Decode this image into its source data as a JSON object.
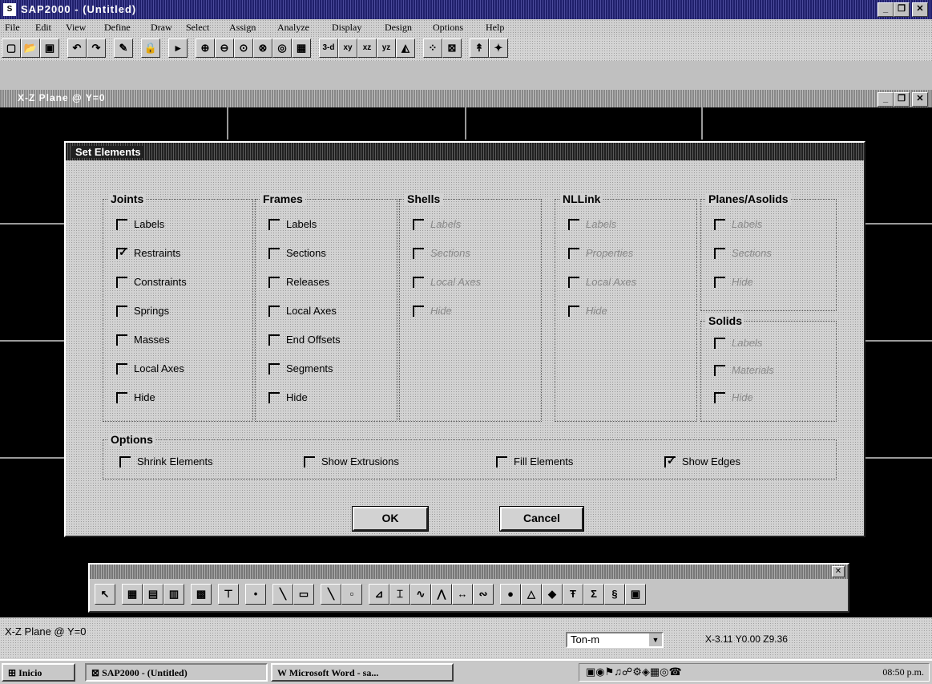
{
  "app": {
    "title": "SAP2000 - (Untitled)",
    "inner_window_title": "X-Z Plane @ Y=0"
  },
  "menu": [
    "File",
    "Edit",
    "View",
    "Define",
    "Draw",
    "Select",
    "Assign",
    "Analyze",
    "Display",
    "Design",
    "Options",
    "Help"
  ],
  "toolbar": {
    "buttons": [
      "new",
      "open",
      "save",
      "undo",
      "redo",
      "edit",
      "lock",
      "run",
      "zoom-in",
      "zoom-out",
      "zoom-window",
      "restore",
      "pan",
      "refresh",
      "3-d",
      "xy",
      "xz",
      "yz",
      "perspective",
      "set-elements",
      "shrink",
      "up",
      "down"
    ],
    "labels": {
      "3d": "3-d",
      "xy": "xy",
      "xz": "xz",
      "yz": "yz"
    }
  },
  "dialog": {
    "title": "Set Elements",
    "groups": {
      "joints": {
        "title": "Joints",
        "items": [
          {
            "label": "Labels",
            "checked": false
          },
          {
            "label": "Restraints",
            "checked": true
          },
          {
            "label": "Constraints",
            "checked": false
          },
          {
            "label": "Springs",
            "checked": false
          },
          {
            "label": "Masses",
            "checked": false
          },
          {
            "label": "Local Axes",
            "checked": false
          },
          {
            "label": "Hide",
            "checked": false
          }
        ]
      },
      "frames": {
        "title": "Frames",
        "items": [
          {
            "label": "Labels",
            "checked": false
          },
          {
            "label": "Sections",
            "checked": false
          },
          {
            "label": "Releases",
            "checked": false
          },
          {
            "label": "Local Axes",
            "checked": false
          },
          {
            "label": "End Offsets",
            "checked": false
          },
          {
            "label": "Segments",
            "checked": false
          },
          {
            "label": "Hide",
            "checked": false
          }
        ]
      },
      "shells": {
        "title": "Shells",
        "items": [
          {
            "label": "Labels",
            "checked": false
          },
          {
            "label": "Sections",
            "checked": false
          },
          {
            "label": "Local Axes",
            "checked": false
          },
          {
            "label": "Hide",
            "checked": false
          }
        ]
      },
      "nllink": {
        "title": "NLLink",
        "items": [
          {
            "label": "Labels",
            "checked": false
          },
          {
            "label": "Properties",
            "checked": false
          },
          {
            "label": "Local Axes",
            "checked": false
          },
          {
            "label": "Hide",
            "checked": false
          }
        ]
      },
      "planes": {
        "title": "Planes/Asolids",
        "items": [
          {
            "label": "Labels",
            "checked": false
          },
          {
            "label": "Sections",
            "checked": false
          },
          {
            "label": "Hide",
            "checked": false
          }
        ]
      },
      "solids": {
        "title": "Solids",
        "items": [
          {
            "label": "Labels",
            "checked": false
          },
          {
            "label": "Materials",
            "checked": false
          },
          {
            "label": "Hide",
            "checked": false
          }
        ]
      },
      "options": {
        "title": "Options",
        "items": [
          {
            "label": "Shrink Elements",
            "checked": false
          },
          {
            "label": "Show Extrusions",
            "checked": false
          },
          {
            "label": "Fill Elements",
            "checked": false
          },
          {
            "label": "Show Edges",
            "checked": true
          }
        ]
      }
    },
    "ok_label": "OK",
    "cancel_label": "Cancel"
  },
  "status": {
    "plane": "X-Z Plane @ Y=0",
    "units": "Ton-m",
    "coords": "X-3.11  Y0.00  Z9.36"
  },
  "taskbar": {
    "start": "Inicio",
    "tasks": [
      "SAP2000 - (Untitled)",
      "Microsoft Word - sa..."
    ],
    "clock": "08:50 p.m."
  }
}
